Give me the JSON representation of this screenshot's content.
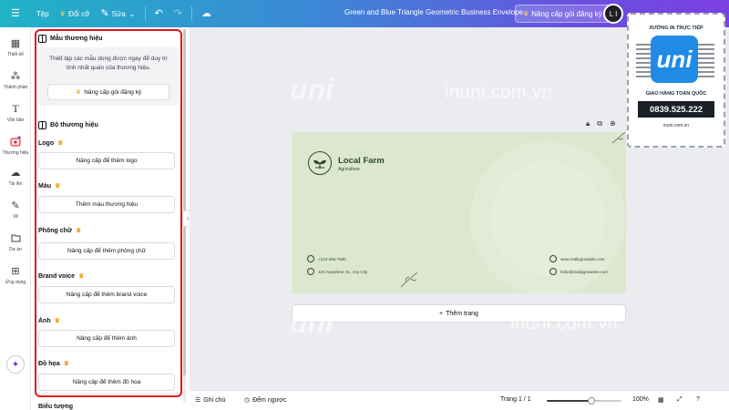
{
  "topbar": {
    "menu_icon": "menu-icon",
    "file_label": "Tệp",
    "resize_label": "Đổi cỡ",
    "edit_label": "Sửa",
    "document_title": "Green and Blue Triangle Geometric Business Envelope",
    "upgrade_label": "Nâng cấp gói đăng ký",
    "avatar_initials": "L I"
  },
  "rail": {
    "items": [
      {
        "label": "Thiết kế",
        "icon": "layout-icon"
      },
      {
        "label": "Thành phần",
        "icon": "elements-icon"
      },
      {
        "label": "Văn bản",
        "icon": "text-icon"
      },
      {
        "label": "Thương hiệu",
        "icon": "brand-icon"
      },
      {
        "label": "Tải lên",
        "icon": "upload-icon"
      },
      {
        "label": "Vẽ",
        "icon": "draw-icon"
      },
      {
        "label": "Dự án",
        "icon": "folder-icon"
      },
      {
        "label": "Ứng dụng",
        "icon": "apps-icon"
      }
    ]
  },
  "panel": {
    "brand_templates_title": "Mẫu thương hiệu",
    "brand_templates_desc": "Thiết lập các mẫu dùng được ngay để duy trì tính nhất quán của thương hiệu.",
    "brand_templates_upgrade": "Nâng cấp gói đăng ký",
    "brand_kit_title": "Bộ thương hiệu",
    "sections": [
      {
        "label": "Logo",
        "button": "Nâng cấp để thêm logo"
      },
      {
        "label": "Màu",
        "button": "Thêm màu thương hiệu"
      },
      {
        "label": "Phông chữ",
        "button": "Nâng cấp để thêm phông chữ"
      },
      {
        "label": "Brand voice",
        "button": "Nâng cấp để thêm brand voice"
      },
      {
        "label": "Ảnh",
        "button": "Nâng cấp để thêm ảnh"
      },
      {
        "label": "Đồ họa",
        "button": "Nâng cấp để thêm đồ họa"
      }
    ],
    "cut_off_label": "Biểu tượng"
  },
  "design": {
    "brand_name": "Local Farm",
    "brand_sub": "Agriculture",
    "phone": "+123-456-7890",
    "address": "123 Anywhere St., Any City",
    "website": "www.reallygreatsite.com",
    "email": "hello@reallygreatsite.com",
    "background_color": "#dde7cf",
    "accent_color": "#2d4a2a"
  },
  "canvas": {
    "add_page_label": "Thêm trang",
    "watermark_text": "inuni.com.vn",
    "watermark_logo": "uni"
  },
  "stamp": {
    "top_text": "XƯỞNG IN TRỰC TIẾP",
    "logo_text": "uni",
    "mid_text": "GIAO HÀNG TOÀN QUỐC",
    "phone": "0839.525.222",
    "url": "inuni.com.vn"
  },
  "bottombar": {
    "notes_label": "Ghi chú",
    "timer_label": "Đếm ngược",
    "page_label": "Trang 1 / 1",
    "zoom_label": "100%",
    "zoom_fraction": 0.6
  }
}
